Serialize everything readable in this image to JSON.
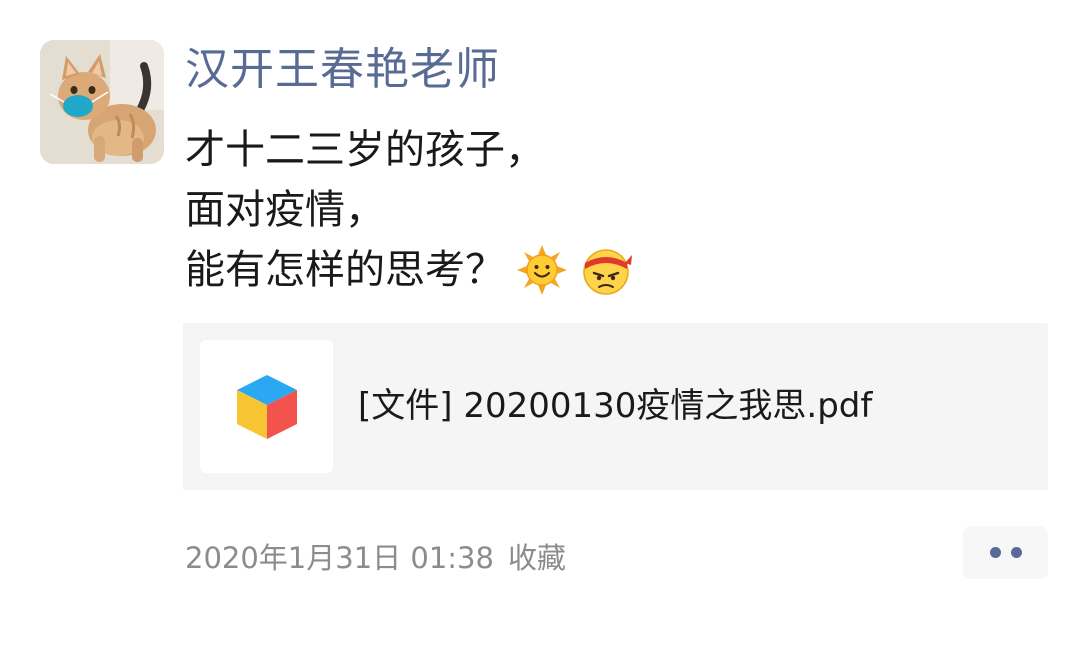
{
  "post": {
    "author": "汉开王春艳老师",
    "avatar_icon": "cat-avatar",
    "lines": [
      "才十二三岁的孩子，",
      "面对疫情，",
      "能有怎样的思考？"
    ],
    "emojis": [
      "sun-emoji",
      "determined-face-emoji"
    ],
    "attachment": {
      "icon": "cube-file-icon",
      "label": "[文件] 20200130疫情之我思.pdf"
    },
    "timestamp": "2020年1月31日 01:38",
    "favorite_label": "收藏",
    "more_icon": "more-dots-icon"
  },
  "colors": {
    "author_name": "#576b95",
    "body_text": "#1a1a1a",
    "meta_text": "#8c8c8c",
    "card_bg": "#f5f5f5"
  }
}
